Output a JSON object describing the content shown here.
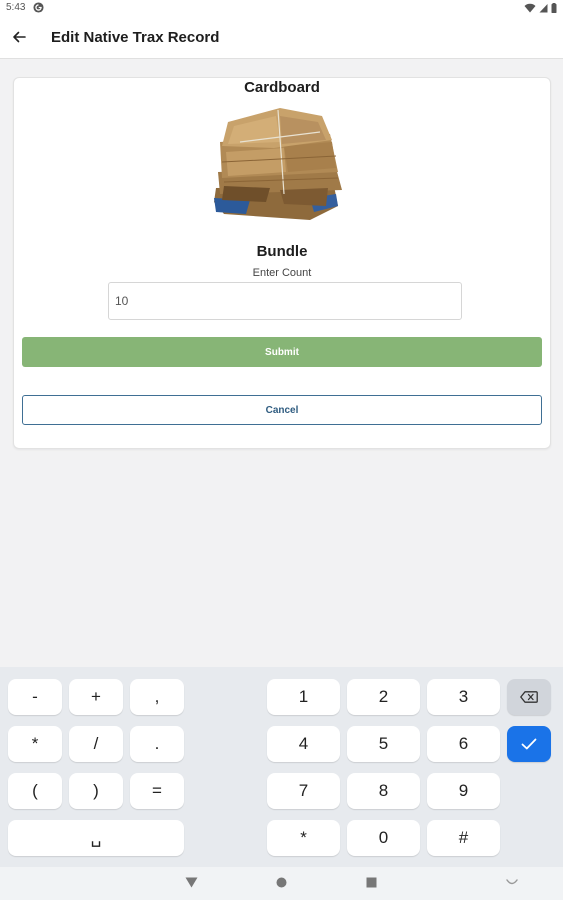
{
  "status_bar": {
    "time": "5:43"
  },
  "app_bar": {
    "title": "Edit Native Trax Record"
  },
  "card": {
    "material": "Cardboard",
    "unit": "Bundle",
    "count_label": "Enter Count",
    "count_value": "10",
    "submit_label": "Submit",
    "cancel_label": "Cancel"
  },
  "keyboard": {
    "symbol_keys": [
      "-",
      "+",
      ",",
      "*",
      "/",
      ".",
      "(",
      ")",
      "="
    ],
    "digit_keys": [
      "1",
      "2",
      "3",
      "4",
      "5",
      "6",
      "7",
      "8",
      "9",
      "*",
      "0",
      "#"
    ],
    "space_key": "␣"
  },
  "colors": {
    "submit": "#87b576",
    "cancel_border": "#3f6f94",
    "enter_key": "#1a73e8"
  }
}
